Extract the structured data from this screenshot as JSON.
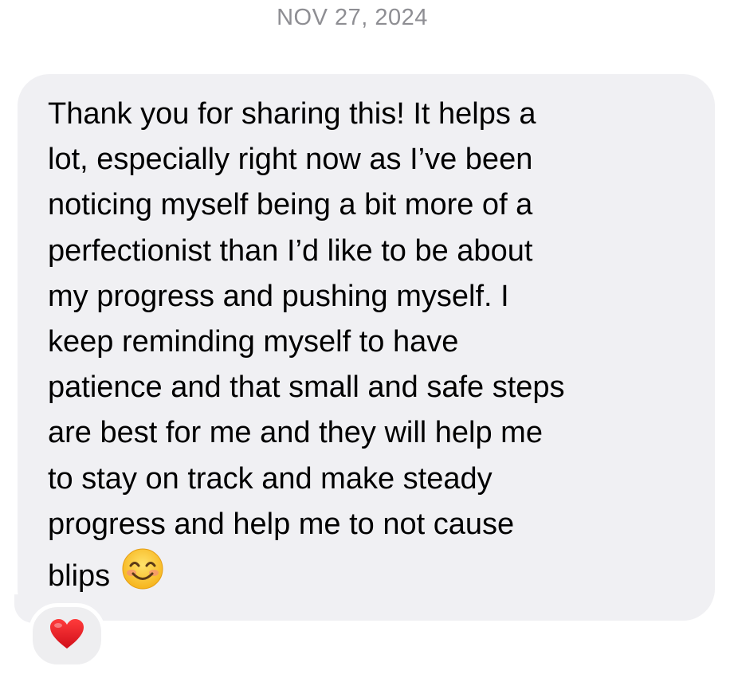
{
  "conversation": {
    "date_header": "NOV 27, 2024"
  },
  "message": {
    "text": "Thank you for sharing this! It helps a\nlot, especially right now as I’ve been\nnoticing myself being a bit more of a\nperfectionist than I’d like to be about\nmy progress and pushing myself. I\nkeep reminding myself to have\npatience and that small and safe steps\nare best for me and they will help me\nto stay on track and make steady\nprogress and help me to not cause\nblips",
    "trailing_emoji": "smiling-face-with-smiling-eyes",
    "bubble_color": "#f0f0f3",
    "text_color": "#000000"
  },
  "reaction": {
    "emoji": "red-heart",
    "color": "#e8141e"
  }
}
